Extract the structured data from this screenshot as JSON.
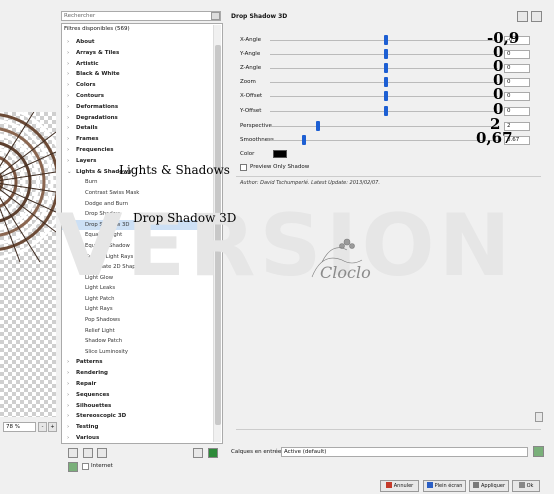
{
  "preview": {
    "zoom_value": "78 %",
    "zoom_minus": "-",
    "zoom_plus": "+"
  },
  "filters": {
    "search_placeholder": "Rechercher",
    "count_label": "Filtres disponibles (569)",
    "categories_top": [
      "About",
      "Arrays & Tiles",
      "Artistic",
      "Black & White",
      "Colors",
      "Contours",
      "Deformations",
      "Degradations",
      "Details",
      "Frames",
      "Frequencies",
      "Layers"
    ],
    "open_category": "Lights & Shadows",
    "subitems": [
      "Burn",
      "Contrast Swiss Mask",
      "Dodge and Burn",
      "Drop Shadow",
      "Drop Shadow 3D",
      "Equalize Light",
      "Equalize Shadow",
      "Guided Light Rays",
      "Illuminate 2D Shape",
      "Light Glow",
      "Light Leaks",
      "Light Patch",
      "Light Rays",
      "Pop Shadows",
      "Relief Light",
      "Shadow Patch",
      "Slice Luminosity"
    ],
    "selected_subitem": "Drop Shadow 3D",
    "categories_bottom": [
      "Patterns",
      "Rendering",
      "Repair",
      "Sequences",
      "Silhouettes",
      "Stereoscopic 3D",
      "Testing",
      "Various"
    ],
    "internet_label": "Internet"
  },
  "params": {
    "title": "Drop Shadow 3D",
    "sliders": [
      {
        "label": "X-Angle",
        "value": "-0,9",
        "spin": "-0.9",
        "pos": 0.51
      },
      {
        "label": "Y-Angle",
        "value": "0",
        "spin": "0",
        "pos": 0.51
      },
      {
        "label": "Z-Angle",
        "value": "0",
        "spin": "0",
        "pos": 0.51
      },
      {
        "label": "Zoom",
        "value": "0",
        "spin": "0",
        "pos": 0.51
      },
      {
        "label": "X-Offset",
        "value": "0",
        "spin": "0",
        "pos": 0.51
      },
      {
        "label": "Y-Offset",
        "value": "0",
        "spin": "0",
        "pos": 0.51
      },
      {
        "label": "Perspective",
        "value": "2",
        "spin": "2",
        "pos": 0.21
      },
      {
        "label": "Smoothness",
        "value": "0,67",
        "spin": "0.67",
        "pos": 0.15
      }
    ],
    "color_label": "Color",
    "preview_only_label": "Preview Only Shadow",
    "author_line": "Author: David Tschumperlé.     Latest Update: 2013/02/07."
  },
  "watermark_text": "VERSION",
  "logo_text": "Cloclo",
  "overlay_labels": {
    "lights_shadows": "Lights & Shadows",
    "drop_shadow_3d": "Drop Shadow 3D"
  },
  "bottom": {
    "calques_label": "Calques en entrée",
    "calques_value": "Active (default)",
    "buttons": {
      "cancel": "Annuler",
      "fullscreen": "Plein écran",
      "apply": "Appliquer",
      "ok": "Ok"
    }
  },
  "colors": {
    "accent": "#1d5fd3",
    "selection": "#cde0f5"
  }
}
